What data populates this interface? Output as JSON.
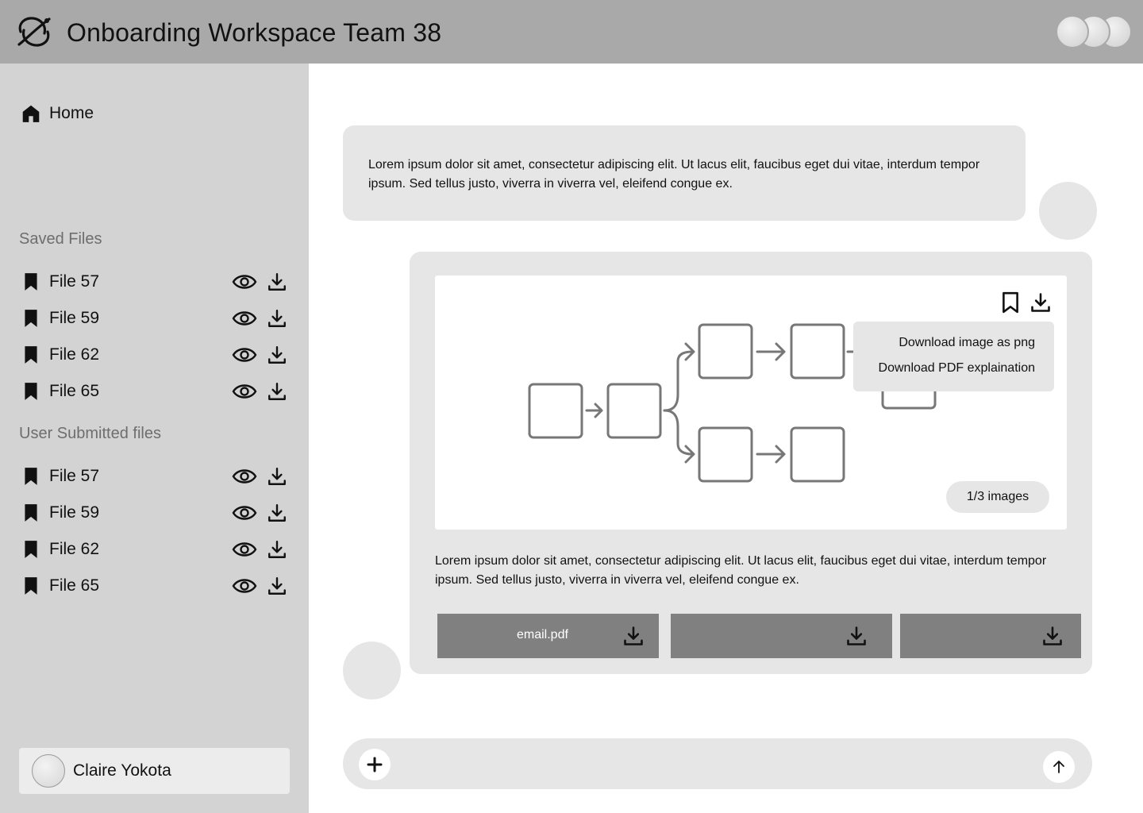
{
  "header": {
    "title": "Onboarding Workspace Team 38",
    "logo_icon": "orbit-logo-icon",
    "avatar_count": 3
  },
  "sidebar": {
    "home_label": "Home",
    "saved_title": "Saved Files",
    "saved_files": [
      {
        "name": "File 57"
      },
      {
        "name": "File 59"
      },
      {
        "name": "File 62"
      },
      {
        "name": "File 65"
      }
    ],
    "submitted_title": "User Submitted files",
    "submitted_files": [
      {
        "name": "File 57"
      },
      {
        "name": "File 59"
      },
      {
        "name": "File 62"
      },
      {
        "name": "File 65"
      }
    ],
    "user_name": "Claire Yokota"
  },
  "chat": {
    "incoming_text": "Lorem ipsum dolor sit amet, consectetur adipiscing elit. Ut lacus elit, faucibus eget dui vitae, interdum tempor ipsum. Sed tellus justo, viverra in viverra vel, eleifend congue ex.",
    "response_text": "Lorem ipsum dolor sit amet, consectetur adipiscing elit. Ut lacus elit, faucibus eget dui vitae, interdum tempor ipsum. Sed tellus justo, viverra in viverra vel, eleifend congue ex.",
    "image_menu": {
      "option_png": "Download image as png",
      "option_pdf": "Download PDF explaination"
    },
    "image_counter": "1/3 images",
    "attachments": [
      {
        "name": "email.pdf"
      },
      {
        "name": ""
      },
      {
        "name": ""
      }
    ]
  },
  "composer": {
    "placeholder": "",
    "plus_icon": "plus-icon",
    "send_icon": "arrow-up-icon"
  },
  "colors": {
    "header_bg": "#a9a9a9",
    "sidebar_bg": "#d3d3d3",
    "bubble_bg": "#e6e6e6",
    "attachment_bg": "#808080",
    "diagram_stroke": "#777777"
  }
}
